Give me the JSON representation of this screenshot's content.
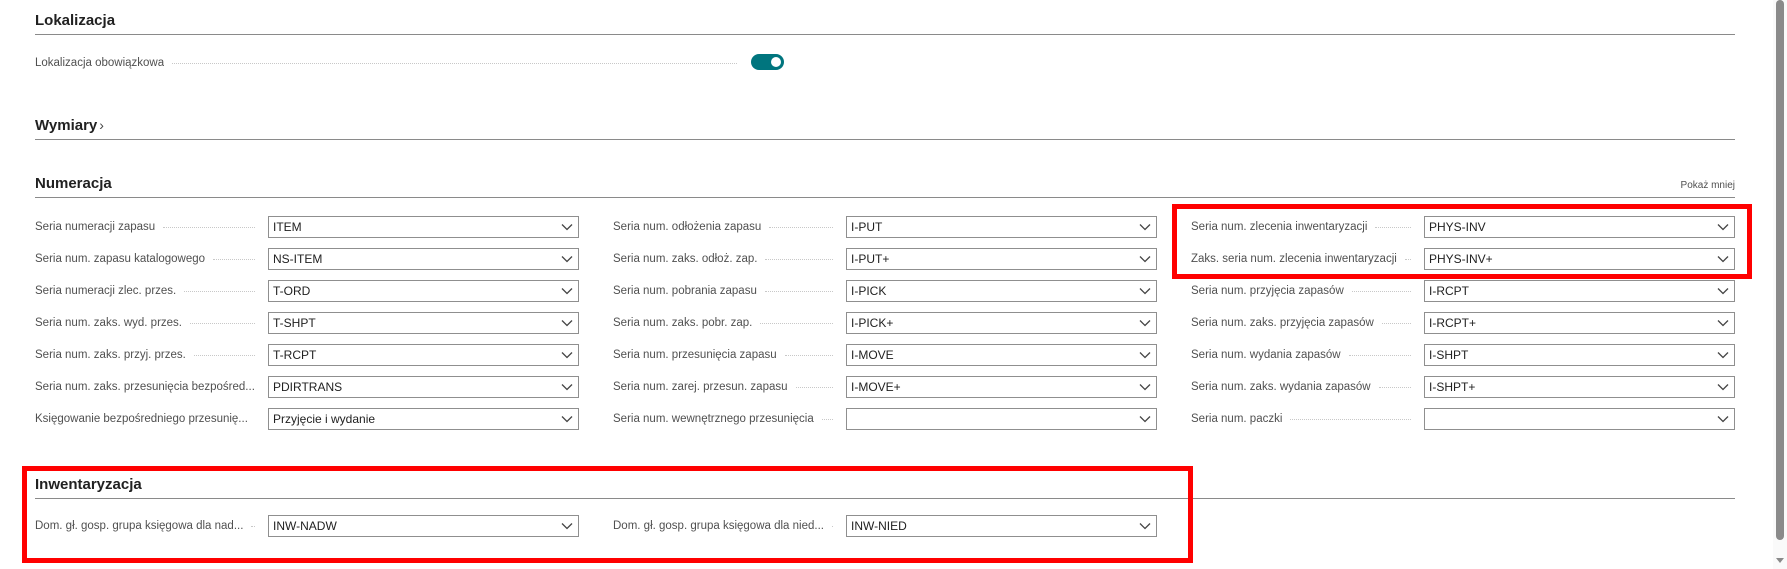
{
  "sections": {
    "lokalizacja": {
      "title": "Lokalizacja"
    },
    "wymiary": {
      "title": "Wymiary",
      "chevron": "›"
    },
    "numeracja": {
      "title": "Numeracja",
      "show_less": "Pokaż mniej"
    },
    "inwentaryzacja": {
      "title": "Inwentaryzacja"
    }
  },
  "lokalizacja": {
    "mandatory_label": "Lokalizacja obowiązkowa",
    "mandatory_on": true
  },
  "numeracja": {
    "col1": [
      {
        "label": "Seria numeracji zapasu",
        "value": "ITEM"
      },
      {
        "label": "Seria num. zapasu katalogowego",
        "value": "NS-ITEM"
      },
      {
        "label": "Seria numeracji zlec. przes.",
        "value": "T-ORD"
      },
      {
        "label": "Seria num. zaks. wyd. przes.",
        "value": "T-SHPT"
      },
      {
        "label": "Seria num. zaks. przyj. przes.",
        "value": "T-RCPT"
      },
      {
        "label": "Seria num. zaks. przesunięcia bezpośred...",
        "value": "PDIRTRANS"
      },
      {
        "label": "Księgowanie bezpośredniego przesunię...",
        "value": "Przyjęcie i wydanie"
      }
    ],
    "col2": [
      {
        "label": "Seria num. odłożenia zapasu",
        "value": "I-PUT"
      },
      {
        "label": "Seria num. zaks. odłoż. zap.",
        "value": "I-PUT+"
      },
      {
        "label": "Seria num. pobrania zapasu",
        "value": "I-PICK"
      },
      {
        "label": "Seria num. zaks. pobr. zap.",
        "value": "I-PICK+"
      },
      {
        "label": "Seria num. przesunięcia zapasu",
        "value": "I-MOVE"
      },
      {
        "label": "Seria num. zarej. przesun. zapasu",
        "value": "I-MOVE+"
      },
      {
        "label": "Seria num. wewnętrznego przesunięcia",
        "value": ""
      }
    ],
    "col3": [
      {
        "label": "Seria num. zlecenia inwentaryzacji",
        "value": "PHYS-INV"
      },
      {
        "label": "Zaks. seria num. zlecenia inwentaryzacji",
        "value": "PHYS-INV+"
      },
      {
        "label": "Seria num. przyjęcia zapasów",
        "value": "I-RCPT"
      },
      {
        "label": "Seria num. zaks. przyjęcia zapasów",
        "value": "I-RCPT+"
      },
      {
        "label": "Seria num. wydania zapasów",
        "value": "I-SHPT"
      },
      {
        "label": "Seria num. zaks. wydania zapasów",
        "value": "I-SHPT+"
      },
      {
        "label": "Seria num. paczki",
        "value": ""
      }
    ]
  },
  "inwentaryzacja": {
    "fields": [
      {
        "label": "Dom. gł. gosp. grupa księgowa dla nad...",
        "value": "INW-NADW"
      },
      {
        "label": "Dom. gł. gosp. grupa księgowa dla nied...",
        "value": "INW-NIED"
      }
    ]
  },
  "colors": {
    "accent": "#00757e",
    "highlight": "#ff0000",
    "divider": "#8a8a8a"
  },
  "icons": {
    "dropdown": "chevron-down-icon",
    "section_expand": "chevron-right-icon"
  }
}
